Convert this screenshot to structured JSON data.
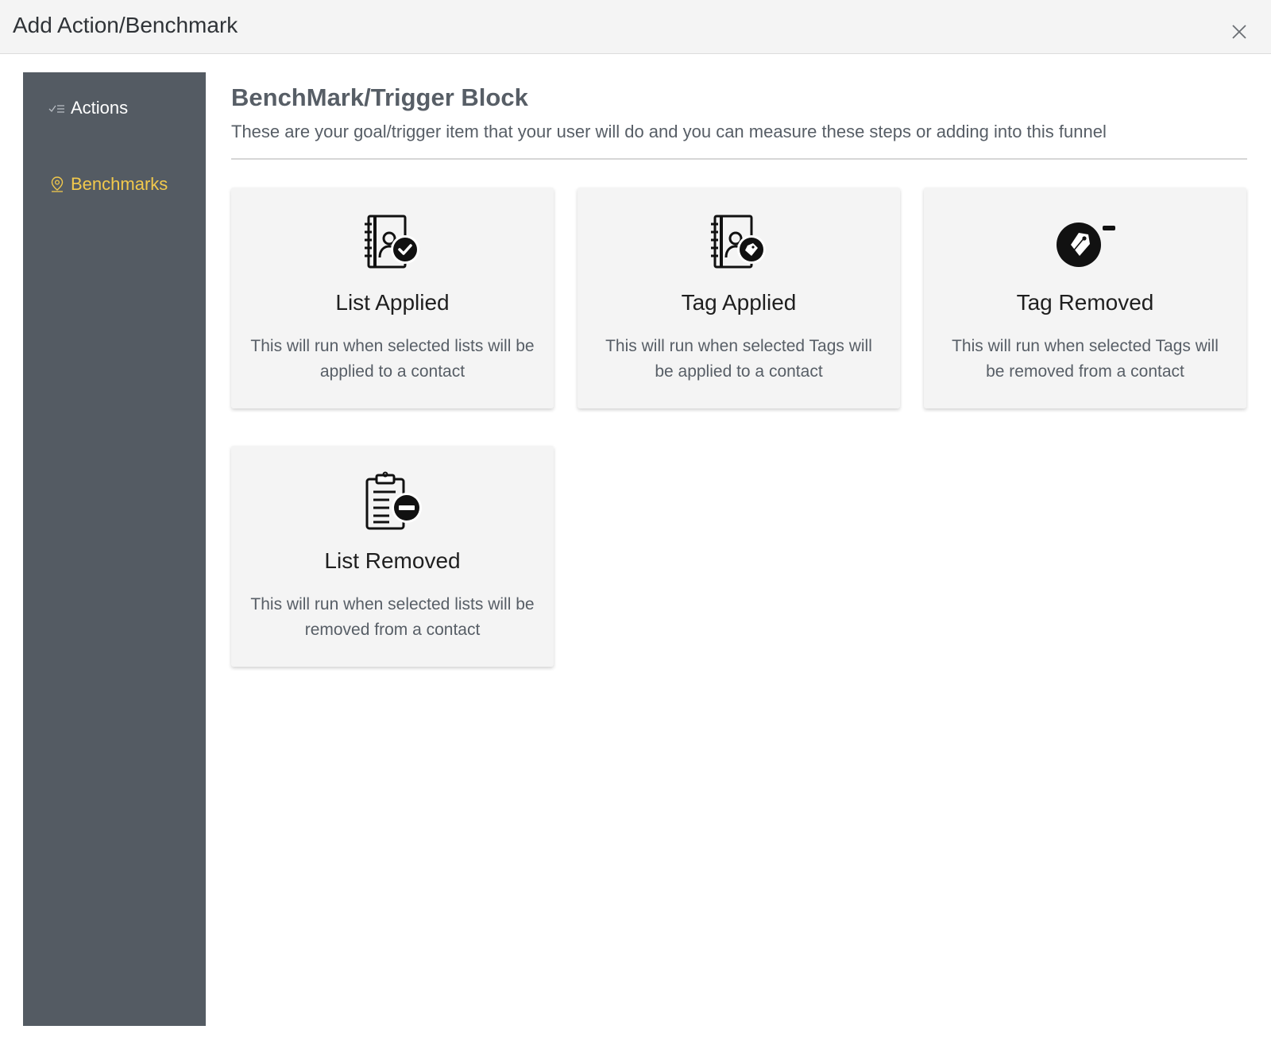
{
  "modal": {
    "title": "Add Action/Benchmark",
    "close_icon": "close-icon"
  },
  "sidebar": {
    "items": [
      {
        "label": "Actions",
        "icon": "checklist-icon",
        "active": false
      },
      {
        "label": "Benchmarks",
        "icon": "location-pin-icon",
        "active": true,
        "color": "#f2c94c"
      }
    ]
  },
  "main": {
    "title": "BenchMark/Trigger Block",
    "description": "These are your goal/trigger item that your user will do and you can measure these steps or adding into this funnel",
    "cards": [
      {
        "title": "List Applied",
        "description": "This will run when selected lists will be applied to a contact",
        "icon": "contact-book-check-icon"
      },
      {
        "title": "Tag Applied",
        "description": "This will run when selected Tags will be applied to a contact",
        "icon": "contact-book-tag-icon"
      },
      {
        "title": "Tag Removed",
        "description": "This will run when selected Tags will be removed from a contact",
        "icon": "tag-minus-icon"
      },
      {
        "title": "List Removed",
        "description": "This will run when selected lists will be removed from a contact",
        "icon": "clipboard-minus-icon"
      }
    ]
  },
  "colors": {
    "sidebar_bg": "#545b63",
    "active_accent": "#f2c94c",
    "card_bg": "#f4f4f4",
    "header_bg": "#f4f4f4"
  }
}
